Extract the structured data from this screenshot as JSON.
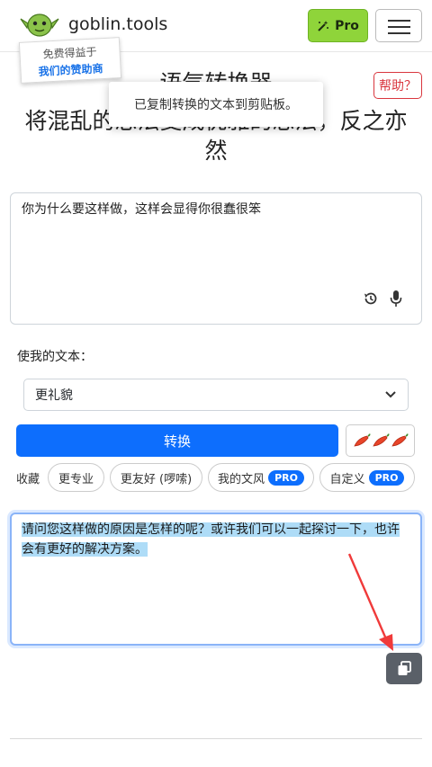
{
  "header": {
    "brand": "goblin.tools",
    "pro_label": "Pro",
    "logo_icon": "goblin-head-icon",
    "menu_icon": "hamburger-icon"
  },
  "sponsor": {
    "line1": "免费得益于",
    "line2": "我们的赞助商"
  },
  "help": {
    "label": "帮助？"
  },
  "page": {
    "title_partial": "语气转换器",
    "subtitle": "将混乱的想法变成优雅的想法，反之亦然"
  },
  "toast": {
    "text": "已复制转换的文本到剪贴板。"
  },
  "input": {
    "value": "你为什么要这样做，这样会显得你很蠢很笨"
  },
  "make": {
    "label": "使我的文本：",
    "selected": "更礼貌"
  },
  "actions": {
    "convert_label": "转换",
    "spice_level": 3,
    "spice_icon": "chili-pepper-icon"
  },
  "favorites": {
    "label": "收藏",
    "chips": [
      {
        "label": "更专业",
        "pro": ""
      },
      {
        "label": "更友好 (啰嗦)",
        "pro": ""
      },
      {
        "label": "我的文风",
        "pro": "PRO"
      },
      {
        "label": "自定义",
        "pro": "PRO"
      }
    ]
  },
  "output": {
    "value": "请问您这样做的原因是怎样的呢？或许我们可以一起探讨一下，也许会有更好的解决方案。"
  },
  "colors": {
    "primary": "#0d6efd",
    "pro_green": "#8fd43a",
    "help_red": "#d9363e",
    "arrow_red": "#f03a3a",
    "highlight": "#aedcf7"
  }
}
